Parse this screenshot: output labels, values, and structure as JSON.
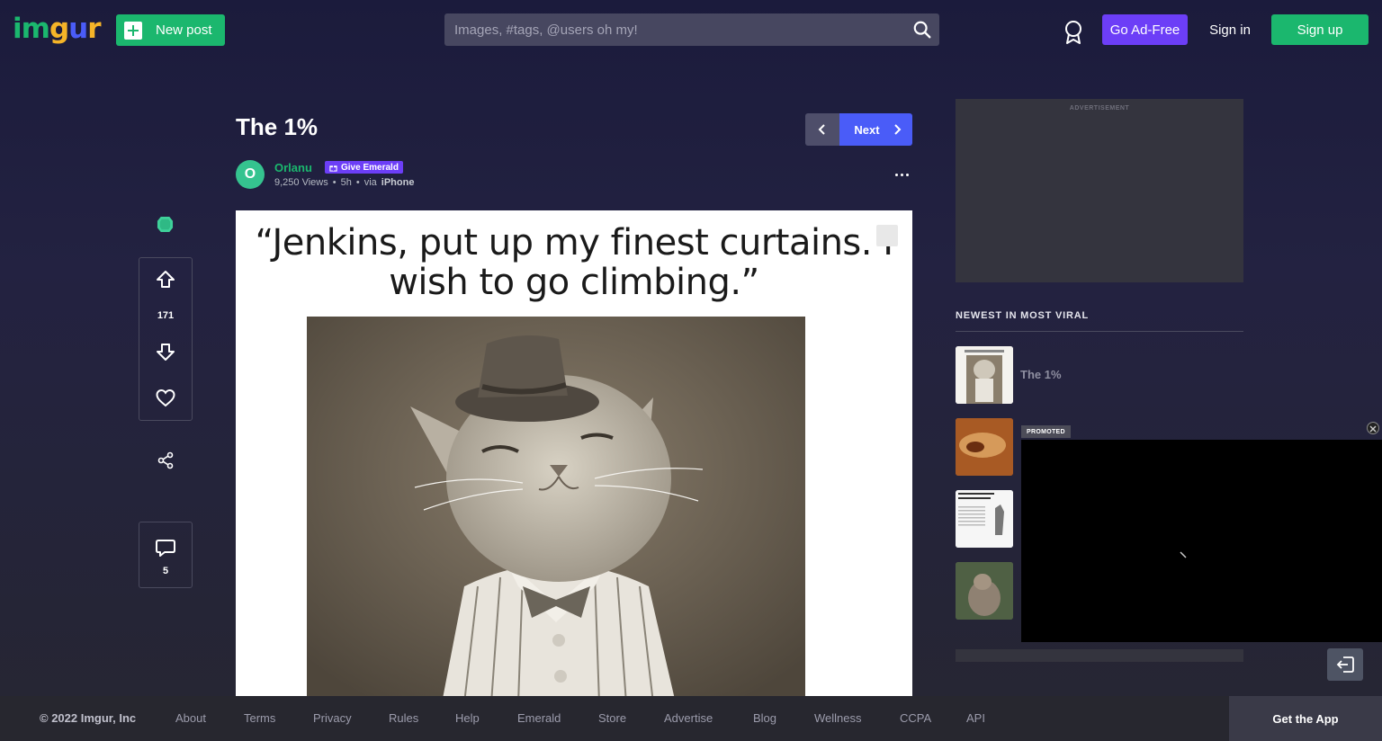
{
  "header": {
    "logo_letters": [
      "i",
      "m",
      "g",
      "u",
      "r"
    ],
    "logo_colors": [
      "#1bb76e",
      "#1bb76e",
      "#f5b428",
      "#6c3ef7",
      "#ee3f43"
    ],
    "new_post_label": "New post",
    "search_placeholder": "Images, #tags, @users oh my!",
    "go_adfree_label": "Go Ad-Free",
    "sign_in_label": "Sign in",
    "sign_up_label": "Sign up"
  },
  "post": {
    "title": "The 1%",
    "next_label": "Next",
    "author": "Orlanu",
    "avatar_letter": "O",
    "give_emerald_label": "Give Emerald",
    "views": "9,250 Views",
    "age": "5h",
    "via_prefix": "via",
    "via_device": "iPhone",
    "image_caption": "“Jenkins, put up my finest curtains. I wish to go climbing.”"
  },
  "rail": {
    "vote_count": "171",
    "comment_count": "5"
  },
  "sidebar": {
    "ad_label": "ADVERTISEMENT",
    "viral_title": "NEWEST IN MOST VIRAL",
    "items": [
      {
        "label": "The 1%"
      }
    ],
    "promoted_label": "PROMOTED"
  },
  "footer": {
    "copyright": "© 2022 Imgur, Inc",
    "links": [
      "About",
      "Terms",
      "Privacy",
      "Rules",
      "Help",
      "Emerald",
      "Store",
      "Advertise",
      "Blog",
      "Wellness",
      "CCPA",
      "API"
    ],
    "get_app_label": "Get the App"
  },
  "colors": {
    "accent_green": "#1bb76e",
    "accent_purple": "#6c3ef7",
    "accent_blue": "#4a5cf8"
  }
}
